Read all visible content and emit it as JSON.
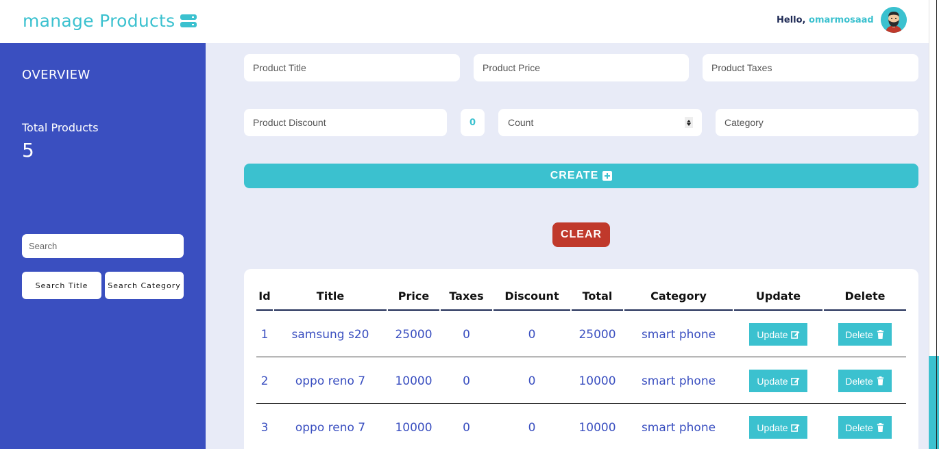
{
  "header": {
    "brand": "manage Products",
    "greeting_prefix": "Hello, ",
    "username": "omarmosaad"
  },
  "sidebar": {
    "overview": "OVERVIEW",
    "total_label": "Total Products",
    "total_value": "5",
    "search_placeholder": "Search",
    "search_title": "Search Title",
    "search_category": "Search Category"
  },
  "form": {
    "title_placeholder": "Product Title",
    "price_placeholder": "Product Price",
    "taxes_placeholder": "Product Taxes",
    "discount_placeholder": "Product Discount",
    "total_value": "0",
    "count_placeholder": "Count",
    "category_placeholder": "Category",
    "create_label": "CREATE",
    "clear_label": "CLEAR"
  },
  "table": {
    "headers": [
      "Id",
      "Title",
      "Price",
      "Taxes",
      "Discount",
      "Total",
      "Category",
      "Update",
      "Delete"
    ],
    "update_label": "Update",
    "delete_label": "Delete",
    "rows": [
      {
        "id": "1",
        "title": "samsung s20",
        "price": "25000",
        "taxes": "0",
        "discount": "0",
        "total": "25000",
        "category": "smart phone"
      },
      {
        "id": "2",
        "title": "oppo reno 7",
        "price": "10000",
        "taxes": "0",
        "discount": "0",
        "total": "10000",
        "category": "smart phone"
      },
      {
        "id": "3",
        "title": "oppo reno 7",
        "price": "10000",
        "taxes": "0",
        "discount": "0",
        "total": "10000",
        "category": "smart phone"
      }
    ]
  },
  "colors": {
    "accent": "#3bc1cf",
    "sidebar": "#3a4fc0",
    "danger": "#c0392b",
    "background": "#e8ebf7"
  }
}
